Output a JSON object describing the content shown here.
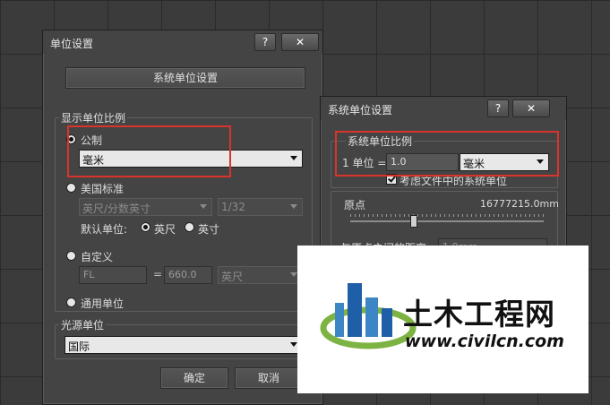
{
  "units_dialog": {
    "title": "单位设置",
    "help_label": "?",
    "close_label": "✕",
    "system_button": "系统单位设置",
    "display_group": "显示单位比例",
    "metric": {
      "label": "公制",
      "selected": "毫米"
    },
    "us": {
      "label": "美国标准",
      "selected": "英尺/分数英寸",
      "fraction": "1/32",
      "default_label": "默认单位:",
      "feet": "英尺",
      "inches": "英寸"
    },
    "custom": {
      "label": "自定义",
      "name": "FL",
      "equals": "=",
      "value": "660.0",
      "unit": "英尺"
    },
    "generic": {
      "label": "通用单位"
    },
    "light_group": "光源单位",
    "light_selected": "国际",
    "ok": "确定",
    "cancel": "取消"
  },
  "system_dialog": {
    "title": "系统单位设置",
    "help_label": "?",
    "close_label": "✕",
    "scale_group": "系统单位比例",
    "unit_label": "1 单位 =",
    "unit_value": "1.0",
    "unit_selected": "毫米",
    "respect_label": "考虑文件中的系统单位",
    "origin_label": "原点",
    "origin_value": "16777215.0mm",
    "distance_label": "与原点之间的距离:",
    "distance_value": "1.0mm"
  },
  "watermark": {
    "brand": "土木工程网",
    "url": "www.civilcn.com"
  },
  "colors": {
    "highlight": "#d9342b",
    "logo_blue": "#1f5fa8",
    "logo_green": "#7cb342"
  }
}
